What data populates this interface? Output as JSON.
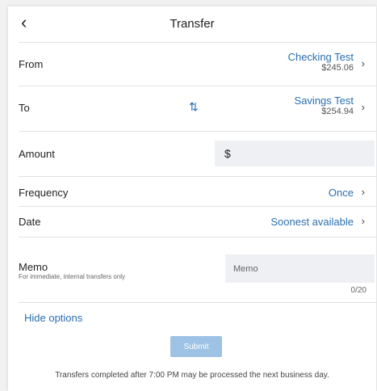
{
  "header": {
    "back_icon": "chevron-left-icon",
    "title": "Transfer"
  },
  "from": {
    "label": "From",
    "account_name": "Checking Test",
    "balance": "$245.06"
  },
  "swap_icon": "swap-vertical-icon",
  "to": {
    "label": "To",
    "account_name": "Savings Test",
    "balance": "$254.94"
  },
  "amount": {
    "label": "Amount",
    "currency_symbol": "$",
    "value": ""
  },
  "frequency": {
    "label": "Frequency",
    "value": "Once"
  },
  "date": {
    "label": "Date",
    "value": "Soonest available"
  },
  "memo": {
    "label": "Memo",
    "sublabel": "For immediate, internal transfers only",
    "placeholder": "Memo",
    "counter": "0/20"
  },
  "options": {
    "hide_label": "Hide options"
  },
  "submit": {
    "label": "Submit"
  },
  "footer_note": "Transfers completed after 7:00 PM may be processed the next business day.",
  "colors": {
    "accent": "#2a6fb0",
    "submit_disabled": "#9ec2e4",
    "input_bg": "#eef0f3"
  }
}
